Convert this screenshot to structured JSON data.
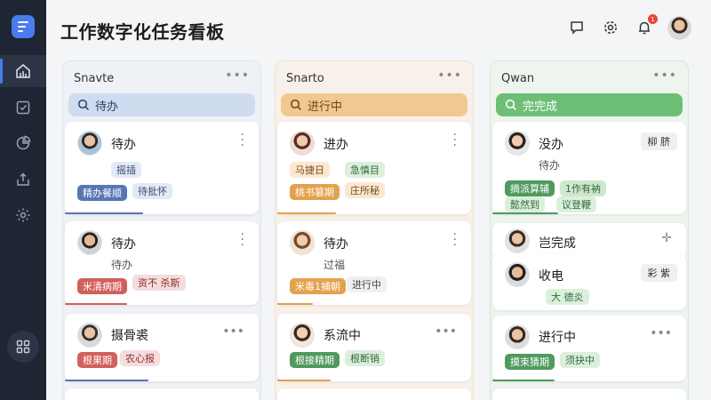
{
  "header": {
    "title": "工作数字化任务看板",
    "notif_count": "1"
  },
  "colors": {
    "accent": "#4a7bf0",
    "sidebar": "#1f2633"
  },
  "nav": [
    {
      "icon": "dashboard-icon"
    },
    {
      "icon": "checkbox-icon"
    },
    {
      "icon": "pie-chart-icon"
    },
    {
      "icon": "upload-icon"
    },
    {
      "icon": "gear-icon"
    }
  ],
  "columns": [
    {
      "name": "Snavte",
      "filter": "待办",
      "cards": [
        {
          "title": "待办",
          "sub": "摇插",
          "tags": [
            "精办餐顺",
            "待批怀"
          ]
        },
        {
          "title": "待办",
          "sub": "待办",
          "tags": [
            "米清病期",
            "资不 杀斯"
          ]
        },
        {
          "title": "摄骨裘",
          "tags": [
            "根果期",
            "农心报"
          ]
        }
      ]
    },
    {
      "name": "Snarto",
      "filter": "进行中",
      "cards": [
        {
          "title": "进办",
          "tags": [
            "马捷日",
            "急慎目",
            "桃书篡期",
            "庄所秘"
          ]
        },
        {
          "title": "待办",
          "sub": "过福",
          "tags": [
            "米毒1捕朝",
            "进行中"
          ]
        },
        {
          "title": "系流中",
          "tags": [
            "根接精期",
            "根断销"
          ]
        }
      ]
    },
    {
      "name": "Qwan",
      "filter": "完完成",
      "cards": [
        {
          "title": "没办",
          "sub": "待办",
          "button": "柳 脐",
          "tags": [
            "摘派算辅",
            "1作有衲",
            "懿然到",
            "议登鞭"
          ]
        },
        {
          "title": "岂完成"
        },
        {
          "title": "收电",
          "button": "彩 紫",
          "tags": [
            "大 德炎"
          ]
        },
        {
          "title": "进行中",
          "tags": [
            "摸束猜期",
            "须抉中"
          ]
        }
      ]
    }
  ]
}
